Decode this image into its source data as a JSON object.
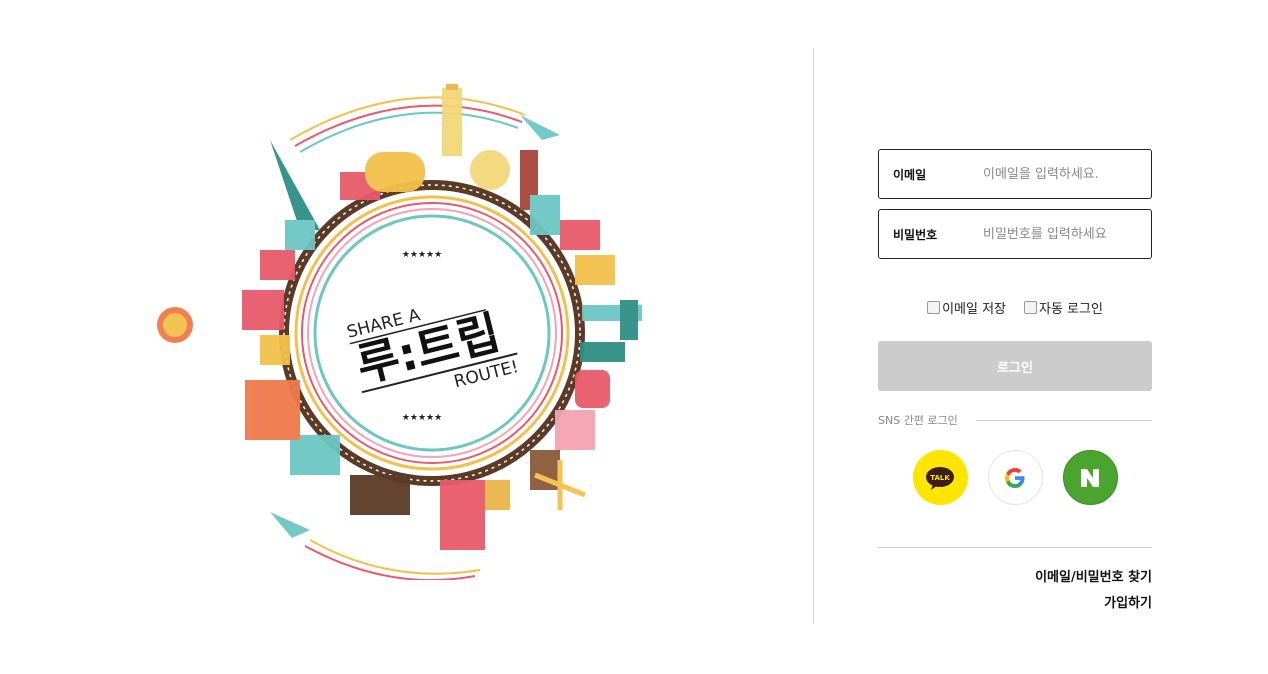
{
  "hero": {
    "logo_top": "SHARE A",
    "logo_main": "루:트립",
    "logo_bottom": "ROUTE!",
    "stars": "★★★★★"
  },
  "login": {
    "email_label": "이메일",
    "email_placeholder": "이메일을 입력하세요.",
    "password_label": "비밀번호",
    "password_placeholder": "비밀번호를 입력하세요.",
    "save_email_label": "이메일 저장",
    "auto_login_label": "자동 로그인",
    "login_button": "로그인",
    "sns_label": "SNS 간편 로그인",
    "kakao_text": "TALK",
    "find_link": "이메일/비밀번호 찾기",
    "signup_link": "가입하기"
  },
  "colors": {
    "kakao": "#fee500",
    "naver": "#4aa52e",
    "button_disabled": "#cccccc"
  }
}
